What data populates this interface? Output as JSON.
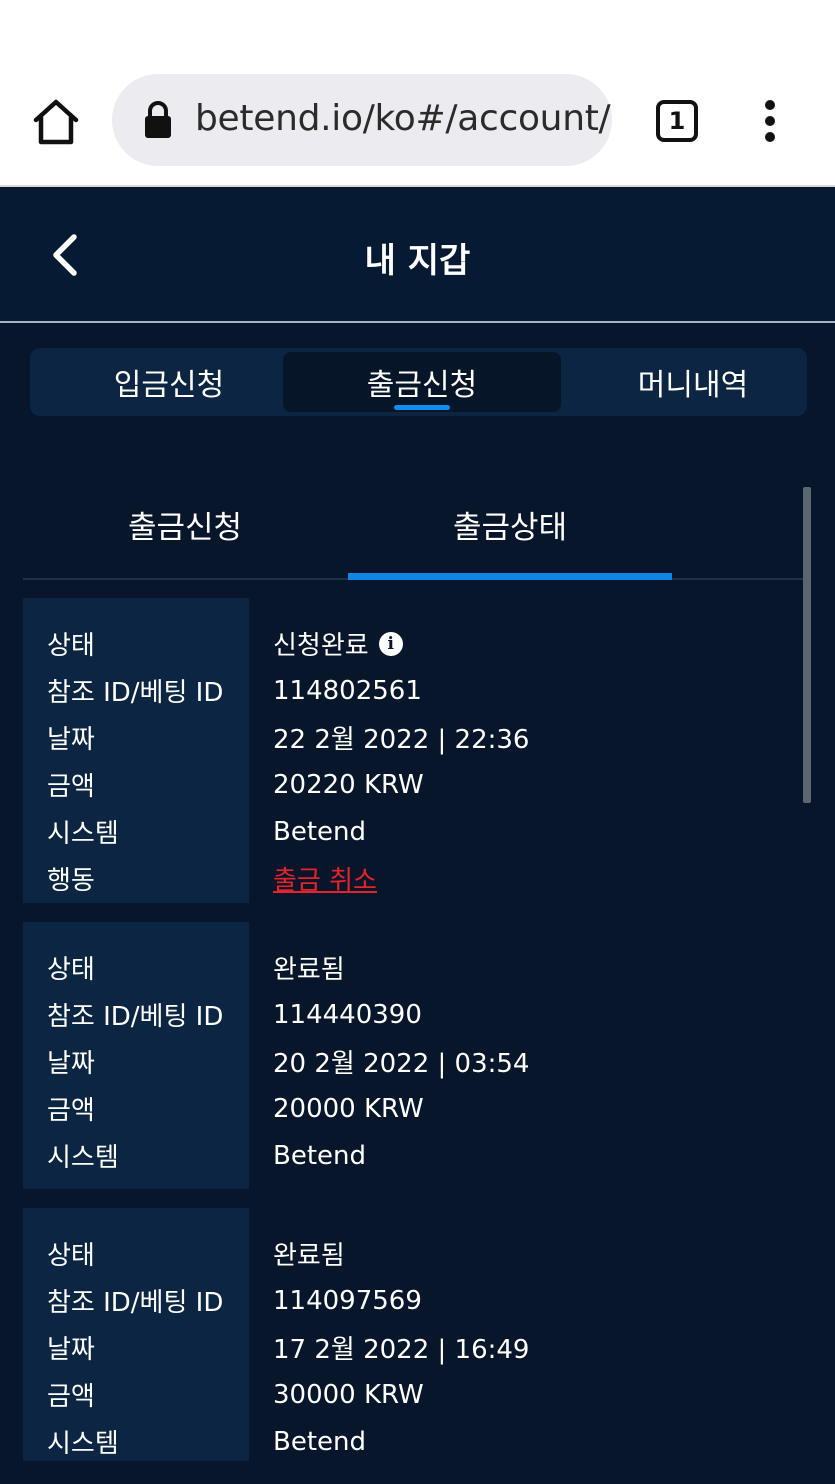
{
  "browser": {
    "url": "betend.io/ko#/account/",
    "tab_count": "1"
  },
  "header": {
    "title": "내 지갑"
  },
  "main_tabs": [
    {
      "label": "입금신청"
    },
    {
      "label": "출금신청"
    },
    {
      "label": "머니내역"
    }
  ],
  "sub_tabs": [
    {
      "label": "출금신청"
    },
    {
      "label": "출금상태"
    }
  ],
  "records": [
    {
      "labels": [
        "상태",
        "참조 ID/베팅 ID",
        "날짜",
        "금액",
        "시스템",
        "행동"
      ],
      "status": "신청완료",
      "ref_id": "114802561",
      "date": "22 2월 2022 | 22:36",
      "amount": "20220 KRW",
      "system": "Betend",
      "action": "출금 취소"
    },
    {
      "labels": [
        "상태",
        "참조 ID/베팅 ID",
        "날짜",
        "금액",
        "시스템"
      ],
      "status": "완료됨",
      "ref_id": "114440390",
      "date": "20 2월 2022 | 03:54",
      "amount": "20000 KRW",
      "system": "Betend"
    },
    {
      "labels": [
        "상태",
        "참조 ID/베팅 ID",
        "날짜",
        "금액",
        "시스템"
      ],
      "status": "완료됨",
      "ref_id": "114097569",
      "date": "17 2월 2022 | 16:49",
      "amount": "30000 KRW",
      "system": "Betend"
    }
  ],
  "colors": {
    "background": "#07162a",
    "panel": "#0b2543",
    "accent": "#0f86e6",
    "cancel": "#e8222b"
  }
}
